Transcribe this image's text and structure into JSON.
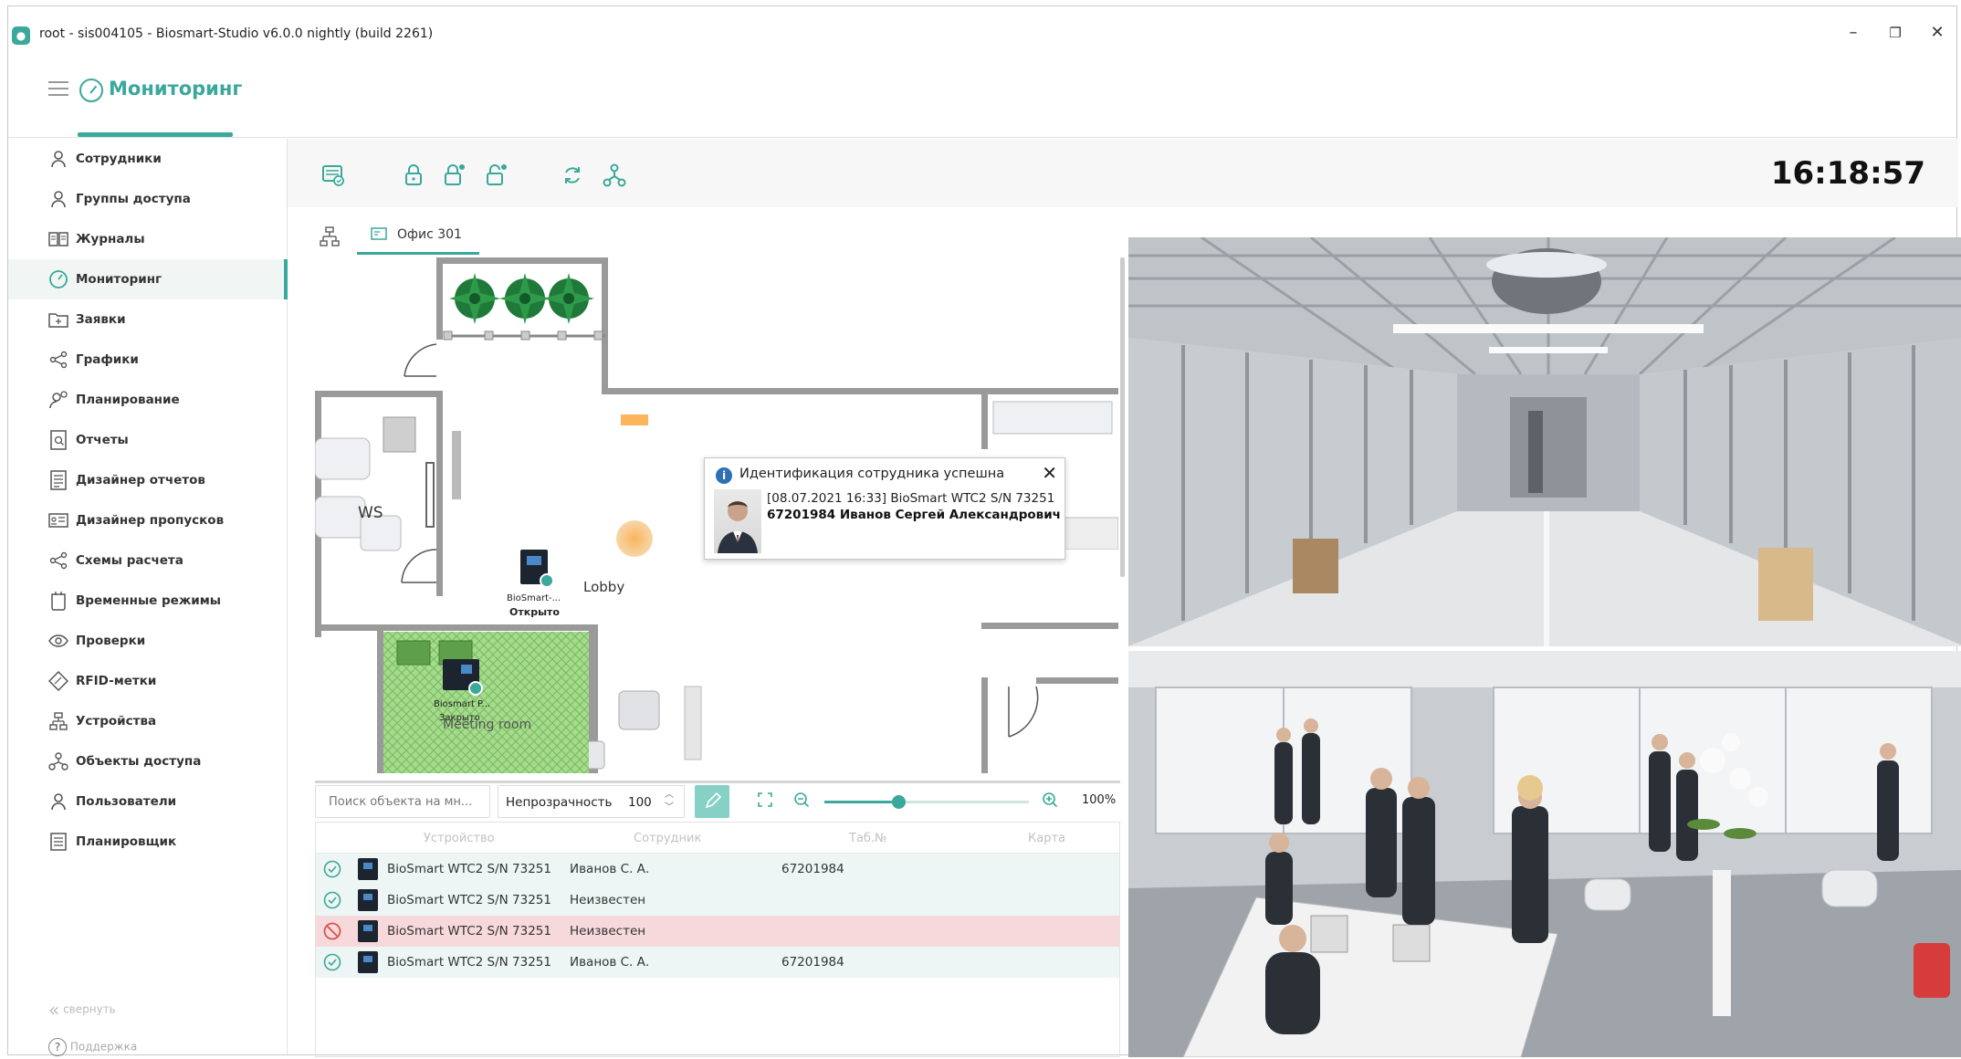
{
  "window": {
    "title": "root - sis004105 - Biosmart-Studio v6.0.0 nightly (build 2261)",
    "minimize": "–",
    "restore": "❐",
    "close": "✕"
  },
  "header": {
    "title": "Мониторинг"
  },
  "sidebar": {
    "items": [
      {
        "label": "Сотрудники",
        "icon": "person-icon"
      },
      {
        "label": "Группы доступа",
        "icon": "group-icon"
      },
      {
        "label": "Журналы",
        "icon": "book-icon"
      },
      {
        "label": "Мониторинг",
        "icon": "gauge-icon",
        "active": true
      },
      {
        "label": "Заявки",
        "icon": "request-icon"
      },
      {
        "label": "Графики",
        "icon": "graph-icon"
      },
      {
        "label": "Планирование",
        "icon": "planning-icon"
      },
      {
        "label": "Отчеты",
        "icon": "report-icon"
      },
      {
        "label": "Дизайнер отчетов",
        "icon": "report-designer-icon"
      },
      {
        "label": "Дизайнер пропусков",
        "icon": "pass-designer-icon"
      },
      {
        "label": "Схемы расчета",
        "icon": "scheme-icon"
      },
      {
        "label": "Временные режимы",
        "icon": "time-mode-icon"
      },
      {
        "label": "Проверки",
        "icon": "eye-icon"
      },
      {
        "label": "RFID-метки",
        "icon": "rfid-icon"
      },
      {
        "label": "Устройства",
        "icon": "devices-icon"
      },
      {
        "label": "Объекты доступа",
        "icon": "access-objects-icon"
      },
      {
        "label": "Пользователи",
        "icon": "user-icon"
      },
      {
        "label": "Планировщик",
        "icon": "scheduler-icon"
      }
    ],
    "collapse": "свернуть",
    "support": "Поддержка"
  },
  "toolbar": {
    "clock": "16:18:57"
  },
  "tabs": {
    "active": "Офис 301"
  },
  "plan": {
    "ws_label": "WS",
    "lobby_label": "Lobby",
    "meeting_label": "Meeting room",
    "device1_name": "BioSmart-...",
    "device1_status": "Открыто",
    "device2_name": "Biosmart P...",
    "device2_status": "Закрыто"
  },
  "popup": {
    "title": "Идентификация сотрудника успешна",
    "line1": "[08.07.2021 16:33] BioSmart WTC2 S/N 73251",
    "line2": "67201984 Иванов Сергей Александрович"
  },
  "map_tools": {
    "search_placeholder": "Поиск объекта на мн...",
    "opacity_label": "Непрозрачность",
    "opacity_value": "100",
    "zoom_percent": "100%",
    "zoom_level": 0.36
  },
  "events": {
    "headers": [
      "Устройство",
      "Сотрудник",
      "Таб.№",
      "Карта"
    ],
    "rows": [
      {
        "status": "ok",
        "device": "BioSmart WTC2 S/N 73251",
        "employee": "Иванов С. А.",
        "tab": "67201984",
        "card": ""
      },
      {
        "status": "ok",
        "device": "BioSmart WTC2 S/N 73251",
        "employee": "Неизвестен",
        "tab": "",
        "card": ""
      },
      {
        "status": "denied",
        "device": "BioSmart WTC2 S/N 73251",
        "employee": "Неизвестен",
        "tab": "",
        "card": ""
      },
      {
        "status": "ok",
        "device": "BioSmart WTC2 S/N 73251",
        "employee": "Иванов С. А.",
        "tab": "67201984",
        "card": ""
      }
    ]
  },
  "colors": {
    "accent": "#3aa89a",
    "denied_row": "#f7d9dc",
    "ok_row": "#edf6f4"
  }
}
